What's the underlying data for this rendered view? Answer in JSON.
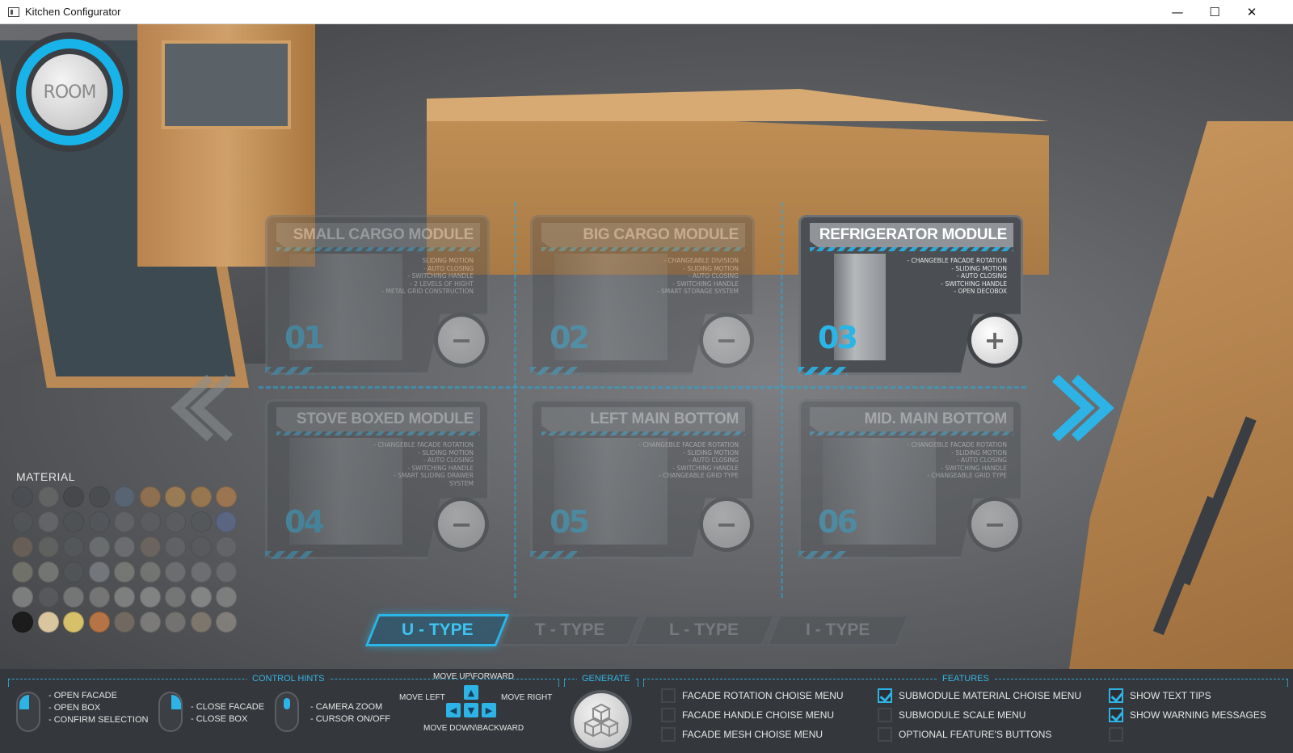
{
  "window": {
    "title": "Kitchen Configurator",
    "minimize": "—",
    "maximize": "☐",
    "close": "✕"
  },
  "room_button": {
    "label": "ROOM"
  },
  "modules": [
    {
      "title": "SMALL CARGO MODULE",
      "number": "01",
      "action": "−",
      "active": false,
      "features": [
        "SLIDING MOTION",
        "- AUTO CLOSING",
        "- SWITCHING HANDLE",
        "- 2 LEVELS OF HIGHT",
        "- METAL GRID CONSTRUCTION"
      ]
    },
    {
      "title": "BIG CARGO MODULE",
      "number": "02",
      "action": "−",
      "active": false,
      "features": [
        "- CHANGEABLE DIVISION",
        "- SLIDING MOTION",
        "- AUTO CLOSING",
        "- SWITCHING HANDLE",
        "- SMART STORAGE SYSTEM"
      ]
    },
    {
      "title": "REFRIGERATOR MODULE",
      "number": "03",
      "action": "+",
      "active": true,
      "features": [
        "- CHANGEBLE FACADE ROTATION",
        "- SLIDING MOTION",
        "- AUTO CLOSING",
        "- SWITCHING HANDLE",
        "- OPEN DECOBOX"
      ]
    },
    {
      "title": "STOVE BOXED MODULE",
      "number": "04",
      "action": "−",
      "active": false,
      "features": [
        "- CHANGEBLE FACADE ROTATION",
        "- SLIDING MOTION",
        "- AUTO CLOSING",
        "- SWITCHING HANDLE",
        "- SMART SLIDING DRAWER SYSTEM"
      ]
    },
    {
      "title": "LEFT MAIN BOTTOM MODULE",
      "number": "05",
      "action": "−",
      "active": false,
      "features": [
        "- CHANGEBLE FACADE ROTATION",
        "- SLIDING MOTION",
        "- AUTO CLOSING",
        "- SWITCHING HANDLE",
        "- CHANGEABLE GRID TYPE"
      ]
    },
    {
      "title": "MID. MAIN BOTTOM MODULE",
      "number": "06",
      "action": "−",
      "active": false,
      "features": [
        "- CHANGEBLE FACADE ROTATION",
        "- SLIDING MOTION",
        "- AUTO CLOSING",
        "- SWITCHING HANDLE",
        "- CHANGEABLE GRID TYPE"
      ]
    }
  ],
  "material": {
    "label": "MATERIAL",
    "swatches": [
      [
        "#4a4d51",
        "#6e6f6c",
        "#3f4245",
        "#45484b",
        "#5d6e84",
        "#b57f49",
        "#c7934f",
        "#c28948",
        "#c8874a"
      ],
      [
        "#55585b",
        "#6f7174",
        "#4f5255",
        "#55585c",
        "#6a6c6f",
        "#5f6164",
        "#5e6063",
        "#55585b",
        "#5d6e9a"
      ],
      [
        "#7a6a5e",
        "#6b6d69",
        "#585b5e",
        "#7c7f80",
        "#7b7d80",
        "#7b6f65",
        "#686a6d",
        "#5a5c5f",
        "#6b6d70"
      ],
      [
        "#8a8b7a",
        "#8d8f8a",
        "#55585b",
        "#8d9096",
        "#8e9088",
        "#8b8c86",
        "#7d7f80",
        "#7e8082",
        "#76787b"
      ],
      [
        "#9fa09d",
        "#5f6164",
        "#8f9190",
        "#8e8f8c",
        "#9d9e9c",
        "#a3a4a2",
        "#8c8e8d",
        "#a5a7a5",
        "#999b99"
      ],
      [
        "#1c1c1c",
        "#d9c69e",
        "#d7c06a",
        "#b57446",
        "#8a7c6a",
        "#9a9894",
        "#8e8a84",
        "#9d8f7e",
        "#a09a92"
      ]
    ]
  },
  "layout_tabs": [
    {
      "label": "U - TYPE",
      "active": true
    },
    {
      "label": "T - TYPE",
      "active": false
    },
    {
      "label": "L - TYPE",
      "active": false
    },
    {
      "label": "I - TYPE",
      "active": false
    }
  ],
  "control_hints": {
    "title": "CONTROL HINTS",
    "left_mouse": "- OPEN FACADE\n- OPEN BOX\n- CONFIRM SELECTION",
    "right_mouse": "- CLOSE FACADE\n- CLOSE BOX",
    "wheel": "- CAMERA ZOOM\n- CURSOR ON/OFF",
    "move_up": "MOVE UP\\FORWARD",
    "move_left": "MOVE LEFT",
    "move_right": "MOVE RIGHT",
    "move_down": "MOVE DOWN\\BACKWARD"
  },
  "generate": {
    "title": "GENERATE"
  },
  "features": {
    "title": "FEATURES",
    "items": [
      {
        "label": "FACADE ROTATION CHOISE MENU",
        "checked": false
      },
      {
        "label": "FACADE HANDLE CHOISE MENU",
        "checked": false
      },
      {
        "label": "FACADE MESH CHOISE MENU",
        "checked": false
      },
      {
        "label": "SUBMODULE MATERIAL CHOISE MENU",
        "checked": true
      },
      {
        "label": "SUBMODULE SCALE MENU",
        "checked": false
      },
      {
        "label": "OPTIONAL FEATURE'S BUTTONS",
        "checked": false
      },
      {
        "label": "SHOW TEXT TIPS",
        "checked": true
      },
      {
        "label": "SHOW WARNING MESSAGES",
        "checked": true
      },
      {
        "label": "",
        "checked": false
      }
    ]
  },
  "colors": {
    "accent": "#2eb3e6",
    "panel": "#34373b"
  }
}
